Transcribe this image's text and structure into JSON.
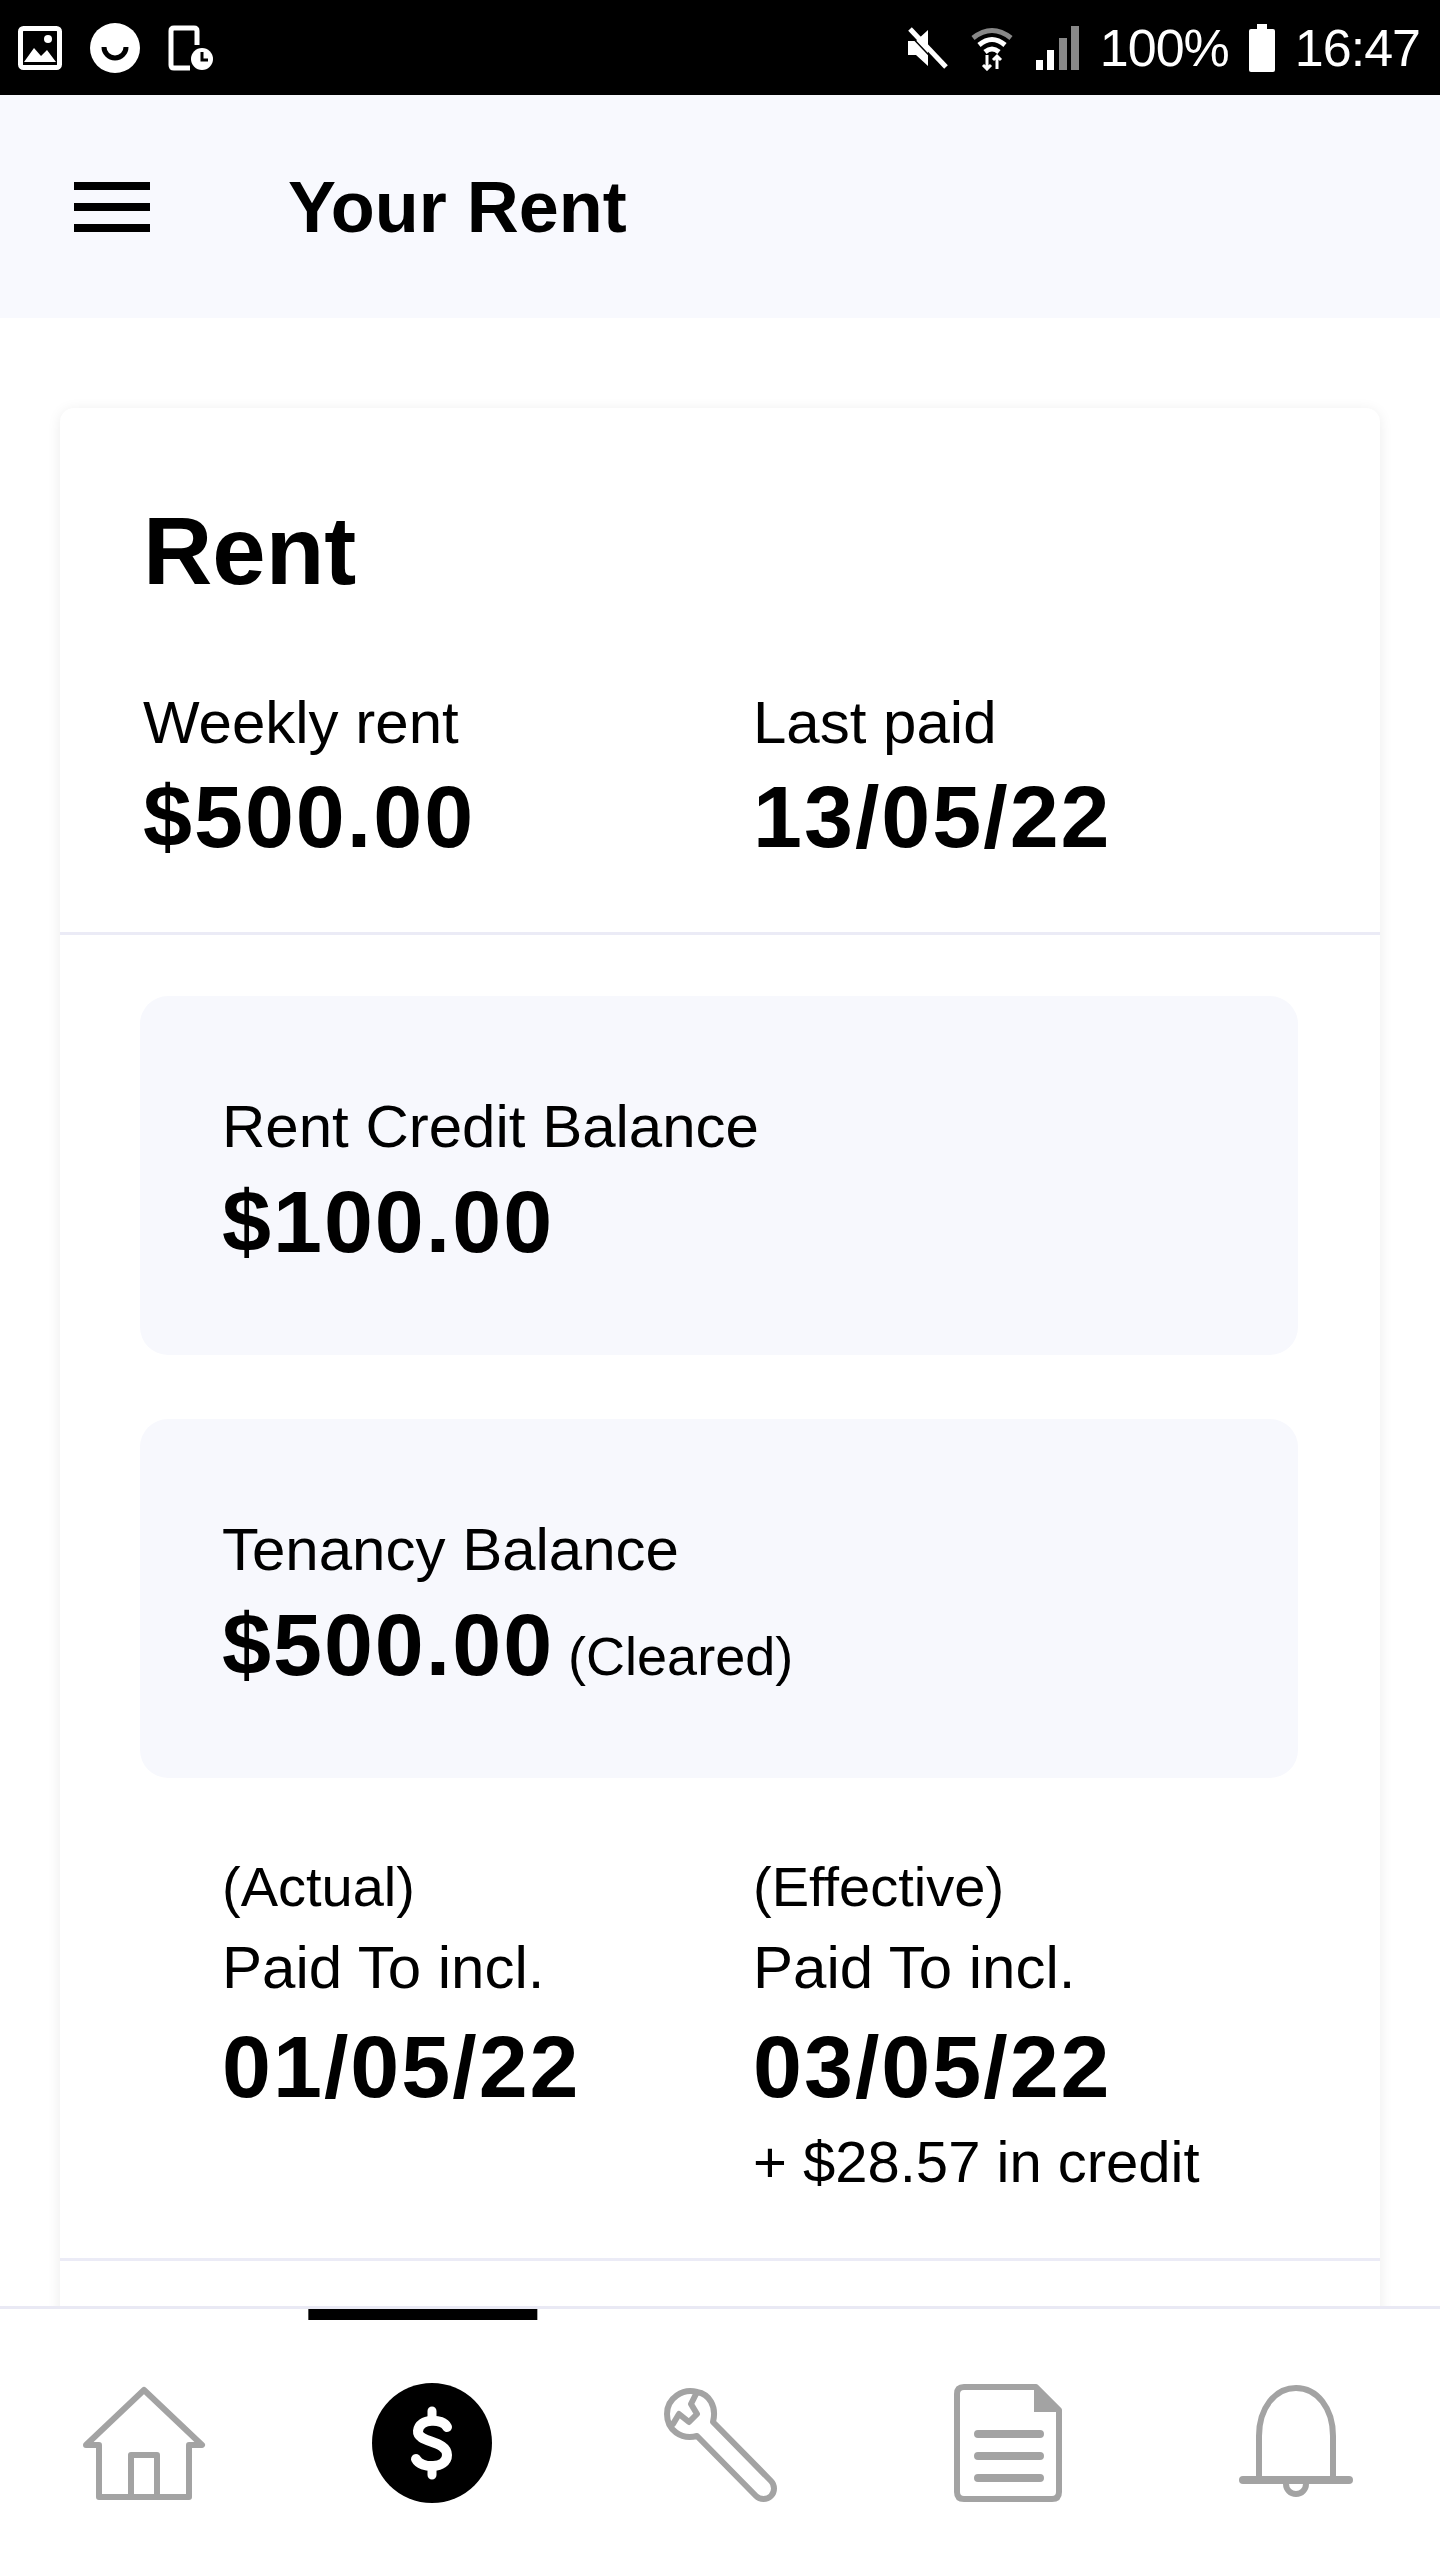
{
  "status_bar": {
    "battery": "100%",
    "time": "16:47"
  },
  "header": {
    "title": "Your Rent"
  },
  "rent_card": {
    "title": "Rent",
    "summary": [
      {
        "label": "Weekly rent",
        "value": "$500.00"
      },
      {
        "label": "Last paid",
        "value": "13/05/22"
      }
    ],
    "balances": [
      {
        "label": "Rent Credit Balance",
        "amount": "$100.00"
      },
      {
        "label": "Tenancy Balance",
        "amount": "$500.00",
        "status": "(Cleared)"
      }
    ],
    "paid_to": [
      {
        "qualifier": "(Actual)",
        "label": "Paid To incl.",
        "date": "01/05/22"
      },
      {
        "qualifier": "(Effective)",
        "label": "Paid To incl.",
        "date": "03/05/22",
        "note": "+ $28.57 in credit"
      }
    ]
  },
  "bottom_nav": [
    {
      "kind": "home",
      "selected": false
    },
    {
      "kind": "dollar",
      "selected": true
    },
    {
      "kind": "wrench",
      "selected": false
    },
    {
      "kind": "document",
      "selected": false
    },
    {
      "kind": "bell",
      "selected": false
    }
  ]
}
